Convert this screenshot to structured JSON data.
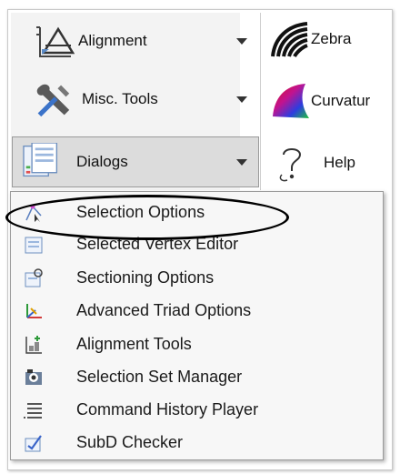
{
  "ribbon": {
    "left": [
      {
        "label": "Alignment",
        "icon": "alignment-icon"
      },
      {
        "label": "Misc. Tools",
        "icon": "misc-tools-icon"
      },
      {
        "label": "Dialogs",
        "icon": "dialogs-icon"
      }
    ],
    "right": [
      {
        "label": "Zebra",
        "icon": "zebra-icon"
      },
      {
        "label": "Curvatur",
        "icon": "curvature-icon"
      },
      {
        "label": "Help",
        "icon": "help-icon"
      }
    ]
  },
  "menu": {
    "items": [
      {
        "label": "Selection Options",
        "icon": "selection-options-icon"
      },
      {
        "label": "Selected Vertex Editor",
        "icon": "vertex-editor-icon"
      },
      {
        "label": "Sectioning Options",
        "icon": "sectioning-options-icon"
      },
      {
        "label": "Advanced Triad Options",
        "icon": "triad-options-icon"
      },
      {
        "label": "Alignment Tools",
        "icon": "alignment-tools-icon"
      },
      {
        "label": "Selection Set Manager",
        "icon": "selection-set-manager-icon"
      },
      {
        "label": "Command History Player",
        "icon": "command-history-icon"
      },
      {
        "label": "SubD Checker",
        "icon": "subd-checker-icon"
      }
    ]
  }
}
